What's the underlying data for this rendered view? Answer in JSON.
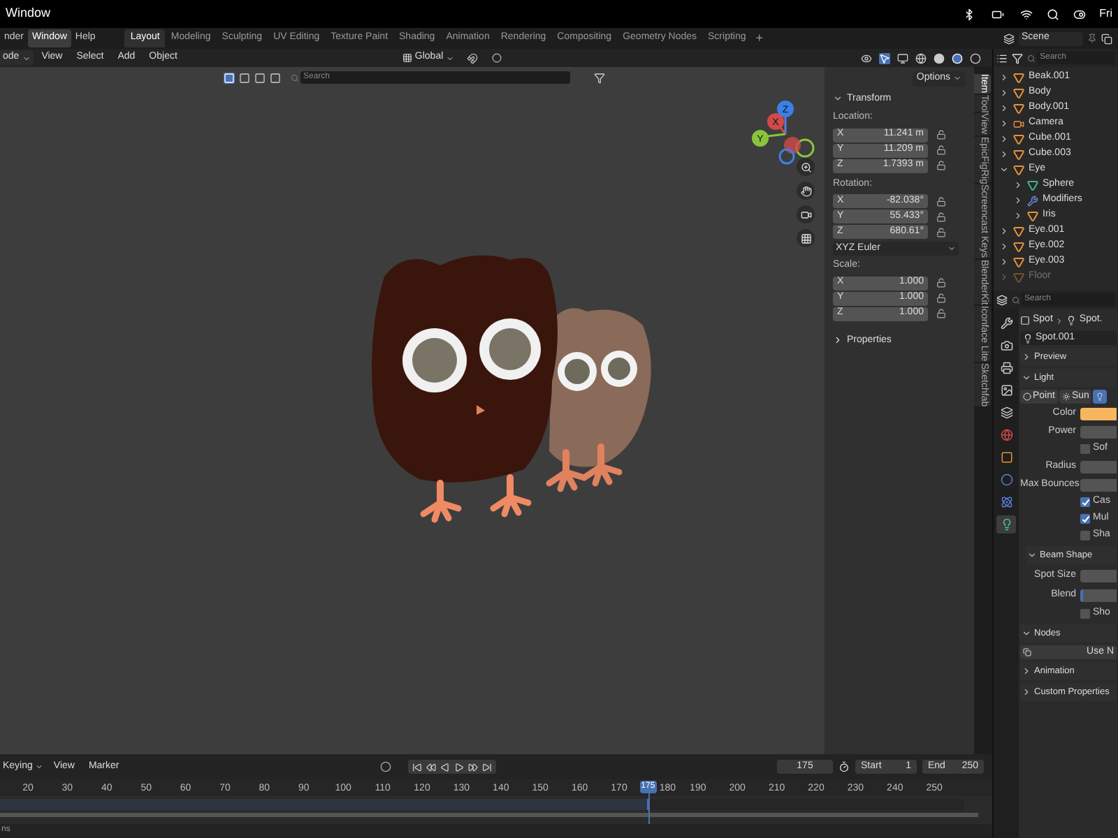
{
  "menubar": {
    "app": "Window",
    "clock": "Fri"
  },
  "topbar": {
    "menus": [
      {
        "label": "nder",
        "selected": false
      },
      {
        "label": "Window",
        "selected": true
      },
      {
        "label": "Help",
        "selected": false
      }
    ],
    "workspaces": [
      {
        "label": "Layout",
        "selected": true
      },
      {
        "label": "Modeling",
        "selected": false
      },
      {
        "label": "Sculpting",
        "selected": false
      },
      {
        "label": "UV Editing",
        "selected": false
      },
      {
        "label": "Texture Paint",
        "selected": false
      },
      {
        "label": "Shading",
        "selected": false
      },
      {
        "label": "Animation",
        "selected": false
      },
      {
        "label": "Rendering",
        "selected": false
      },
      {
        "label": "Compositing",
        "selected": false
      },
      {
        "label": "Geometry Nodes",
        "selected": false
      },
      {
        "label": "Scripting",
        "selected": false
      }
    ],
    "add": "+",
    "scene": "Scene"
  },
  "header": {
    "mode": "ode",
    "menus": [
      "View",
      "Select",
      "Add",
      "Object"
    ],
    "orientation": "Global"
  },
  "viewport": {
    "search": {
      "placeholder": "Search"
    },
    "axes": [
      "Z",
      "X",
      "Y"
    ]
  },
  "sidebar": {
    "options": "Options",
    "panel": "Transform",
    "expanded": true,
    "groups": [
      {
        "label": "Location:",
        "fields": [
          {
            "axis": "X",
            "value": "11.241 m"
          },
          {
            "axis": "Y",
            "value": "11.209 m"
          },
          {
            "axis": "Z",
            "value": "1.7393 m"
          }
        ]
      },
      {
        "label": "Rotation:",
        "fields": [
          {
            "axis": "X",
            "value": "-82.038°"
          },
          {
            "axis": "Y",
            "value": "55.433°"
          },
          {
            "axis": "Z",
            "value": "680.61°"
          }
        ],
        "mode": "XYZ Euler"
      },
      {
        "label": "Scale:",
        "fields": [
          {
            "axis": "X",
            "value": "1.000"
          },
          {
            "axis": "Y",
            "value": "1.000"
          },
          {
            "axis": "Z",
            "value": "1.000"
          }
        ]
      }
    ],
    "properties": "Properties"
  },
  "sidebar_tabs": [
    {
      "label": "Item",
      "selected": true
    },
    {
      "label": "Tool",
      "selected": false
    },
    {
      "label": "View",
      "selected": false
    },
    {
      "label": "EpicFigRig",
      "selected": false
    },
    {
      "label": "Screencast Keys",
      "selected": false
    },
    {
      "label": "BlenderKit",
      "selected": false
    },
    {
      "label": "Iconface Lite",
      "selected": false
    },
    {
      "label": "Sketchfab",
      "selected": false
    }
  ],
  "outliner": {
    "search": {
      "placeholder": "Search"
    },
    "items": [
      {
        "name": "Beak.001",
        "kind": "object",
        "expanded": false,
        "disabled": false
      },
      {
        "name": "Body",
        "kind": "object",
        "expanded": false,
        "disabled": false
      },
      {
        "name": "Body.001",
        "kind": "object",
        "expanded": false,
        "disabled": false
      },
      {
        "name": "Camera",
        "kind": "camera",
        "expanded": false,
        "disabled": false
      },
      {
        "name": "Cube.001",
        "kind": "object",
        "expanded": false,
        "disabled": false
      },
      {
        "name": "Cube.003",
        "kind": "object",
        "expanded": false,
        "disabled": false
      },
      {
        "name": "Eye",
        "kind": "object",
        "expanded": true,
        "disabled": false,
        "children": [
          {
            "name": "Sphere",
            "kind": "mesh",
            "expanded": false,
            "disabled": false
          },
          {
            "name": "Modifiers",
            "kind": "modifier",
            "expanded": false,
            "disabled": false
          },
          {
            "name": "Iris",
            "kind": "object",
            "expanded": false,
            "disabled": false
          }
        ]
      },
      {
        "name": "Eye.001",
        "kind": "object",
        "expanded": false,
        "disabled": false
      },
      {
        "name": "Eye.002",
        "kind": "object",
        "expanded": false,
        "disabled": false
      },
      {
        "name": "Eye.003",
        "kind": "object",
        "expanded": false,
        "disabled": false
      },
      {
        "name": "Floor",
        "kind": "object",
        "expanded": false,
        "disabled": true
      }
    ]
  },
  "properties": {
    "search": {
      "placeholder": "Search"
    },
    "tabs": [
      {
        "kind": "tool",
        "selected": false
      },
      {
        "kind": "render",
        "selected": false
      },
      {
        "kind": "output",
        "selected": false
      },
      {
        "kind": "view_layer",
        "selected": false
      },
      {
        "kind": "scene",
        "selected": false
      },
      {
        "kind": "world",
        "selected": false
      },
      {
        "kind": "object",
        "selected": false
      },
      {
        "kind": "physics",
        "selected": false
      },
      {
        "kind": "constraints",
        "selected": false
      },
      {
        "kind": "data",
        "selected": true
      }
    ],
    "breadcrumb": [
      "Spot",
      "Spot."
    ],
    "datablock": "Spot.001",
    "preview": {
      "label": "Preview",
      "expanded": false
    },
    "light": {
      "label": "Light",
      "expanded": true,
      "types": [
        {
          "kind": "point",
          "label": "Point",
          "selected": false
        },
        {
          "kind": "sun",
          "label": "Sun",
          "selected": false
        },
        {
          "kind": "spot",
          "selected": true
        }
      ],
      "rows": [
        {
          "kind": "color",
          "label": "Color",
          "color": "#f8b560"
        },
        {
          "kind": "field",
          "label": "Power"
        },
        {
          "kind": "checkbox",
          "label": "Sof",
          "checked": false
        },
        {
          "kind": "field",
          "label": "Radius"
        },
        {
          "kind": "field",
          "label": "Max Bounces"
        },
        {
          "kind": "checkbox",
          "label": "Cas",
          "checked": true
        },
        {
          "kind": "checkbox",
          "label": "Mul",
          "checked": true
        },
        {
          "kind": "checkbox",
          "label": "Sha",
          "checked": false
        }
      ]
    },
    "beam_shape": {
      "label": "Beam Shape",
      "expanded": true,
      "rows": [
        {
          "kind": "field",
          "label": "Spot Size"
        },
        {
          "kind": "slider",
          "label": "Blend",
          "level": 0.06
        },
        {
          "kind": "checkbox",
          "label": "Sho",
          "checked": false
        }
      ]
    },
    "nodes": {
      "label": "Nodes",
      "expanded": true,
      "button": "Use N"
    },
    "collapsed": [
      {
        "label": "Animation",
        "expanded": false
      },
      {
        "label": "Custom Properties",
        "expanded": false
      }
    ]
  },
  "timeline": {
    "keying": "Keying",
    "menus": [
      "View",
      "Marker"
    ],
    "current_frame": "175",
    "start_label": "Start",
    "start": "1",
    "end_label": "End",
    "end": "250",
    "ticks": [
      "20",
      "30",
      "40",
      "50",
      "60",
      "70",
      "80",
      "90",
      "100",
      "110",
      "120",
      "130",
      "140",
      "150",
      "160",
      "170",
      "180",
      "190",
      "200",
      "210",
      "220",
      "230",
      "240",
      "250"
    ],
    "playhead": {
      "frame": "175",
      "level": 0.672
    }
  },
  "status_bar": "ns"
}
